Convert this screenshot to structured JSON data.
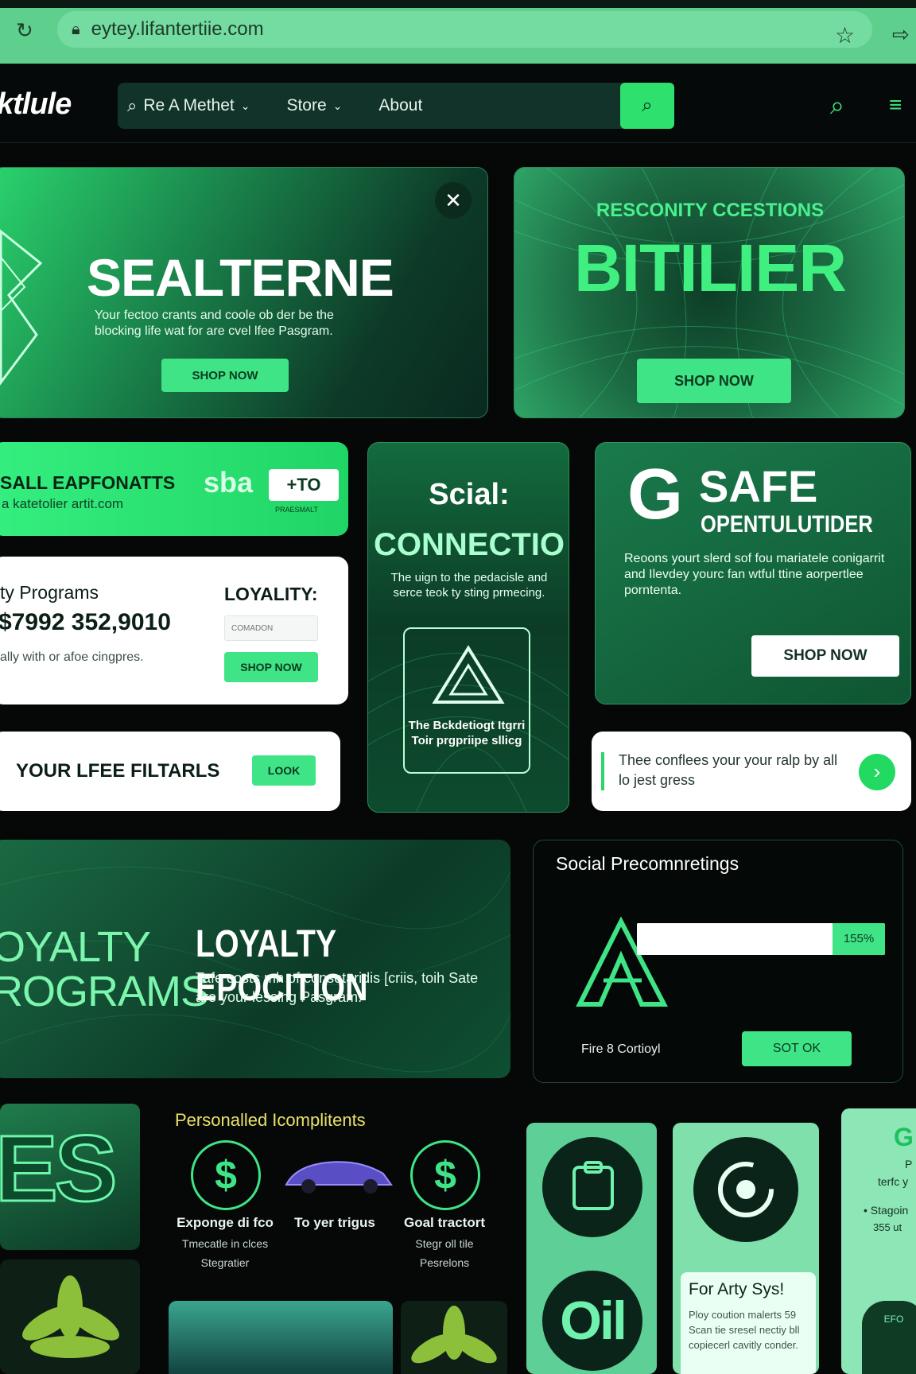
{
  "browser": {
    "url": "eytey.lifantertiie.com"
  },
  "site": {
    "logo": "ktlule",
    "nav": [
      {
        "label": "Re A Methet",
        "has_caret": true
      },
      {
        "label": "Store",
        "has_caret": true
      },
      {
        "label": "About"
      }
    ]
  },
  "hero_left": {
    "title": "SEALTERNE",
    "body": "Your fectoo crants and coole ob der be the blocking life wat for are cvel lfee Pasgram.",
    "button": "SHOP NOW"
  },
  "hero_right": {
    "kicker": "RESCONITY CCESTIONS",
    "title": "BITILIER",
    "button": "SHOP NOW"
  },
  "promo": {
    "title": "SALL EAPFONATTS",
    "url": "a katetolier artit.com",
    "brand": "sba",
    "tag": "+TO",
    "tag_sub": "PRAESMALT"
  },
  "loyalty_card": {
    "label": "ty Programs",
    "amount": "$7992 352,9010",
    "note": "ally with or afoe cingpres.",
    "heading": "LOYALITY:",
    "input_placeholder": "COMADON",
    "button": "SHOP NOW"
  },
  "filters": {
    "title": "YOUR LFEE FILTARLS",
    "button": "LOOK"
  },
  "social_card": {
    "title": "Scial:",
    "subtitle": "CONNECTIO",
    "body": "The uign to the pedacisle and serce teok ty sting prmecing.",
    "inner_text": "The Bckdetiogt Itgrri Toir prgpriipe sllicg"
  },
  "safe_card": {
    "logo_letter": "G",
    "title": "SAFE",
    "subtitle": "OPENTULUTIDER",
    "body": "Reoons yourt slerd sof fou mariatele conigarrit and Ilevdey yourc fan wtful ttine aorpertlee porntenta.",
    "button": "SHOP NOW"
  },
  "tip_card": {
    "text": "Thee conflees your your ralp by all lo jest gress"
  },
  "loyalty_banner": {
    "side_title_1": "OYALTY",
    "side_title_2": "ROGRAMS",
    "title": "LOYALTY EPOCITION",
    "body": "Tafe costs mh of consetaridis [criis, toih Sate are your lessing Pasgram."
  },
  "precon": {
    "title": "Social Precomnretings",
    "progress_label": "155%",
    "progress": 0.92,
    "footer_label": "Fire 8 Cortioyl",
    "button": "SOT OK"
  },
  "personal": {
    "title": "Personalled Icomplitents",
    "items": [
      {
        "title": "Exponge di fco",
        "sub1": "Tmecatle in clces",
        "sub2": "Stegratier"
      },
      {
        "title": "To yer trigus",
        "sub1": "",
        "sub2": ""
      },
      {
        "title": "Goal tractort",
        "sub1": "Stegr oll tile",
        "sub2": "Pesrelons"
      }
    ]
  },
  "tiles": {
    "es_text": "ES",
    "oil_text": "Oil",
    "arty_title": "For Arty Sys!",
    "arty_body": "Ploy coution malerts 59 Scan tie sresel nectiy bll copiecerl cavitly conder.",
    "side_letter": "G",
    "side_line1": "P",
    "side_line2": "terfc y",
    "side_line3": "• Stagoin",
    "side_line4": "355 ut",
    "side_badge": "EFO"
  },
  "colors": {
    "accent": "#3fe486",
    "dark": "#050806",
    "card_green": "#1a7a4b"
  }
}
